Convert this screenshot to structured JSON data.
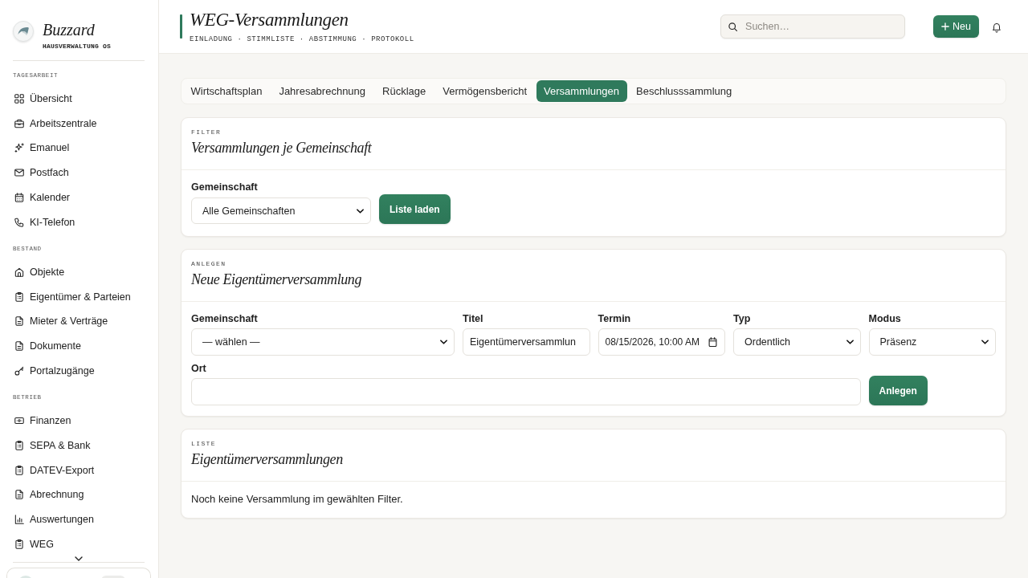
{
  "sidebar": {
    "brand": {
      "name": "Buzzard",
      "tagline": "HAUSVERWALTUNG OS"
    },
    "sections": [
      {
        "title": "TAGESARBEIT",
        "items": [
          {
            "label": "Übersicht"
          },
          {
            "label": "Arbeitszentrale"
          },
          {
            "label": "Emanuel"
          },
          {
            "label": "Postfach"
          },
          {
            "label": "Kalender"
          },
          {
            "label": "KI-Telefon"
          }
        ]
      },
      {
        "title": "BESTAND",
        "items": [
          {
            "label": "Objekte"
          },
          {
            "label": "Eigentümer & Parteien"
          },
          {
            "label": "Mieter & Verträge"
          },
          {
            "label": "Dokumente"
          },
          {
            "label": "Portalzugänge"
          }
        ]
      },
      {
        "title": "BETRIEB",
        "items": [
          {
            "label": "Finanzen"
          },
          {
            "label": "SEPA & Bank"
          },
          {
            "label": "DATEV-Export"
          },
          {
            "label": "Abrechnung"
          },
          {
            "label": "Auswertungen"
          },
          {
            "label": "WEG"
          }
        ]
      }
    ]
  },
  "header": {
    "title": "WEG-Versammlungen",
    "subtitle": "EINLADUNG · STIMMLISTE · ABSTIMMUNG · PROTOKOLL",
    "search": {
      "placeholder": "Suchen…"
    },
    "new_button": "Neu"
  },
  "tabs": [
    {
      "label": "Wirtschaftsplan",
      "selected": false
    },
    {
      "label": "Jahresabrechnung",
      "selected": false
    },
    {
      "label": "Rücklage",
      "selected": false
    },
    {
      "label": "Vermögensbericht",
      "selected": false
    },
    {
      "label": "Versammlungen",
      "selected": true
    },
    {
      "label": "Beschlusssammlung",
      "selected": false
    }
  ],
  "cards": [
    {
      "kind": "filter",
      "eyebrow": "FILTER",
      "title": "Versammlungen je Gemeinschaft",
      "fields": [
        {
          "kind": "select",
          "label": "Gemeinschaft",
          "value": "Alle Gemeinschaften"
        }
      ],
      "button": "Liste laden"
    },
    {
      "kind": "create",
      "eyebrow": "ANLEGEN",
      "title": "Neue Eigentümerversammlung",
      "fields": [
        {
          "kind": "select",
          "label": "Gemeinschaft",
          "value": "— wählen —"
        },
        {
          "kind": "text",
          "label": "Titel",
          "value": "Eigentümerversammlun"
        },
        {
          "kind": "datetime",
          "label": "Termin",
          "value": "08/15/2026, 10:00 AM"
        },
        {
          "kind": "select",
          "label": "Typ",
          "value": "Ordentlich"
        },
        {
          "kind": "select",
          "label": "Modus",
          "value": "Präsenz"
        },
        {
          "kind": "text",
          "label": "Ort"
        }
      ],
      "button": "Anlegen"
    },
    {
      "kind": "list",
      "eyebrow": "LISTE",
      "title": "Eigentümerversammlungen",
      "empty_text": "Noch keine Versammlung im gewählten Filter."
    }
  ]
}
